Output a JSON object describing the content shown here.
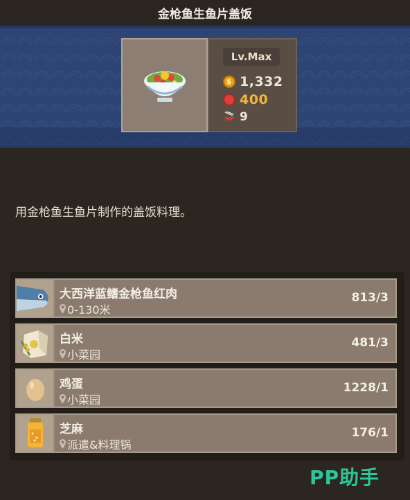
{
  "title": "金枪鱼生鱼片盖饭",
  "dish": {
    "level": "Lv.Max",
    "price": "1,332",
    "taste": "400",
    "servings": "9",
    "icon": "rice-bowl-icon"
  },
  "description": "用金枪鱼生鱼片制作的盖饭料理。",
  "ingredients": [
    {
      "name": "大西洋蓝鳍金枪鱼红肉",
      "location": "0-130米",
      "count": "813/3",
      "icon": "tuna-icon"
    },
    {
      "name": "白米",
      "location": "小菜园",
      "count": "481/3",
      "icon": "rice-bag-icon"
    },
    {
      "name": "鸡蛋",
      "location": "小菜园",
      "count": "1228/1",
      "icon": "egg-icon"
    },
    {
      "name": "芝麻",
      "location": "派遣&料理锅",
      "count": "176/1",
      "icon": "sesame-jar-icon"
    }
  ],
  "watermark": "PP助手",
  "colors": {
    "banner": "#2d4474",
    "taste": "#f0b73a",
    "watermark": "#2fc59b"
  }
}
